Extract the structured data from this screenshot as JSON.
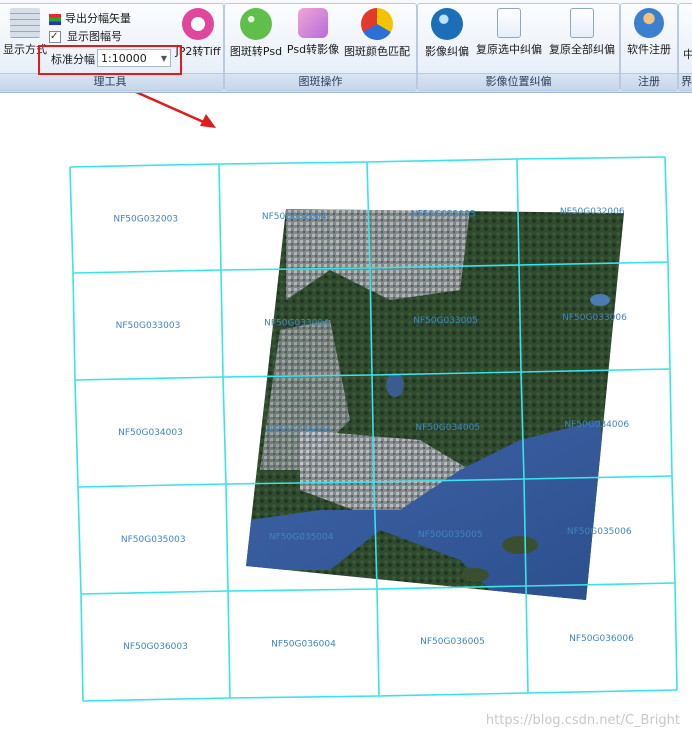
{
  "ribbon": {
    "groups": [
      {
        "label": "理工具"
      },
      {
        "label": "图斑操作"
      },
      {
        "label": "影像位置纠偏"
      },
      {
        "label": "注册"
      },
      {
        "label": "界"
      }
    ],
    "tool": {
      "display_btn": "显示方式",
      "export_label": "导出分幅矢量",
      "show_sheet_label": "显示图幅号",
      "show_sheet_checked": true,
      "scale_label": "标准分幅",
      "scale_value": "1:10000",
      "jp2_btn": "JP2转Tiff"
    },
    "patch": {
      "to_psd": "图斑转Psd",
      "psd_to_img": "Psd转影像",
      "color_match": "图斑颜色匹配"
    },
    "correction": {
      "img_correct": "影像纠偏",
      "restore_selected": "复原选中纠偏",
      "restore_all": "复原全部纠偏"
    },
    "register": {
      "software_reg": "软件注册"
    },
    "extra_char": "中"
  },
  "map": {
    "sheets": [
      [
        "NF50G032003",
        "NF50G032004",
        "NF50G032005",
        "NF50G032006"
      ],
      [
        "NF50G033003",
        "NF50G033004",
        "NF50G033005",
        "NF50G033006"
      ],
      [
        "NF50G034003",
        "NF50G034004",
        "NF50G034005",
        "NF50G034006"
      ],
      [
        "NF50G035003",
        "NF50G035004",
        "NF50G035005",
        "NF50G035006"
      ],
      [
        "NF50G036003",
        "NF50G036004",
        "NF50G036005",
        "NF50G036006"
      ]
    ],
    "grid_color": "#39e3ea",
    "annotation_color": "#e01b1b"
  },
  "watermark": "https://blog.csdn.net/C_Bright"
}
